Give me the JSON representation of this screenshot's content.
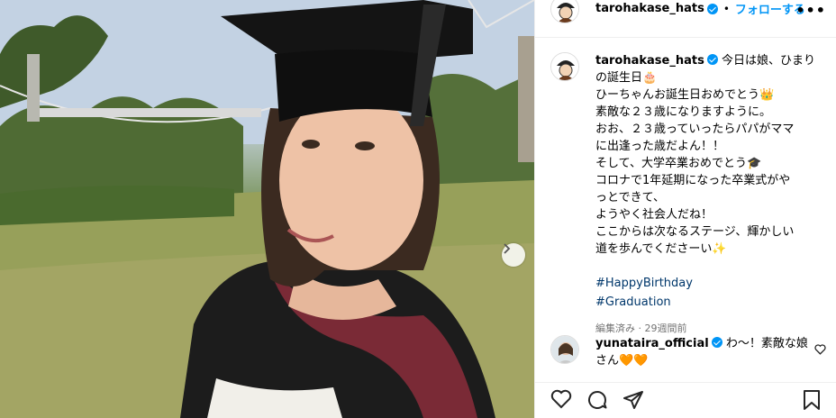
{
  "post": {
    "author": "tarohakase_hats",
    "follow_label": "フォロー",
    "follow_suffix": "する",
    "separator": "•",
    "more": "•••"
  },
  "caption": {
    "author": "tarohakase_hats",
    "lines": [
      "今日は娘、ひまり",
      "の誕生日🎂",
      "ひーちゃんお誕生日おめでとう👑",
      "素敵な２３歳になりますように。",
      "おお、２３歳っていったらパパがママ",
      "に出逢った歳だよん！！",
      "そして、大学卒業おめでとう🎓",
      "コロナで1年延期になった卒業式がや",
      "っとできて、",
      "ようやく社会人だね！",
      "ここからは次なるステージ、輝かしい",
      "道を歩んでくださーい✨"
    ],
    "hashtags": [
      "#HappyBirthday",
      "#Graduation"
    ],
    "meta": "編集済み · 29週間前"
  },
  "comment": {
    "author": "yunataira_official",
    "text": "わ〜！素敵な娘",
    "text2": "さん🧡🧡"
  },
  "icons": {
    "next": "chevron-right-icon",
    "like": "heart-icon",
    "comment": "comment-icon",
    "share": "share-icon",
    "save": "bookmark-icon"
  },
  "colors": {
    "accent": "#0095f6",
    "hashtag": "#00376b",
    "meta": "#737373"
  }
}
